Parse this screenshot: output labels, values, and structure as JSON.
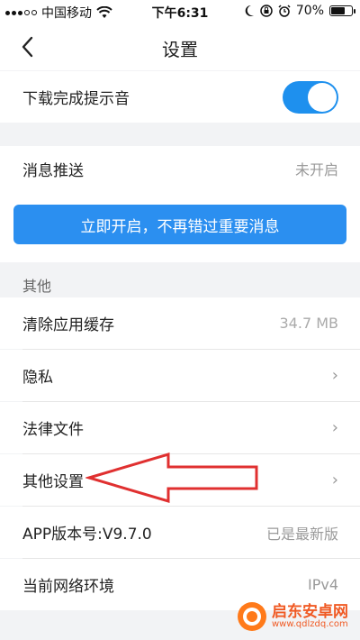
{
  "status_bar": {
    "carrier": "中国移动",
    "time": "下午6:31",
    "battery": "70%",
    "battery_level": 0.7,
    "icons": [
      "signal-icon",
      "wifi-icon",
      "moon-icon",
      "rotation-lock-icon",
      "alarm-icon",
      "battery-icon"
    ]
  },
  "nav": {
    "title": "设置",
    "back_icon": "chevron-left-icon"
  },
  "download_sound": {
    "label": "下载完成提示音",
    "enabled": true
  },
  "push": {
    "label": "消息推送",
    "value": "未开启",
    "cta_label": "立即开启，不再错过重要消息"
  },
  "other": {
    "header": "其他",
    "items": [
      {
        "label": "清除应用缓存",
        "value": "34.7 MB"
      },
      {
        "label": "隐私",
        "value": "›"
      },
      {
        "label": "法律文件",
        "value": "›"
      },
      {
        "label": "其他设置",
        "value": "›"
      },
      {
        "label": "APP版本号:V9.7.0",
        "value": "已是最新版"
      },
      {
        "label": "当前网络环境",
        "value": "IPv4"
      }
    ]
  },
  "watermark": {
    "line1": "启东安卓网",
    "line2": "www.qdlzdq.com"
  },
  "colors": {
    "accent": "#1e90ee",
    "button": "#2b8ff0",
    "annotation": "#e03030"
  }
}
